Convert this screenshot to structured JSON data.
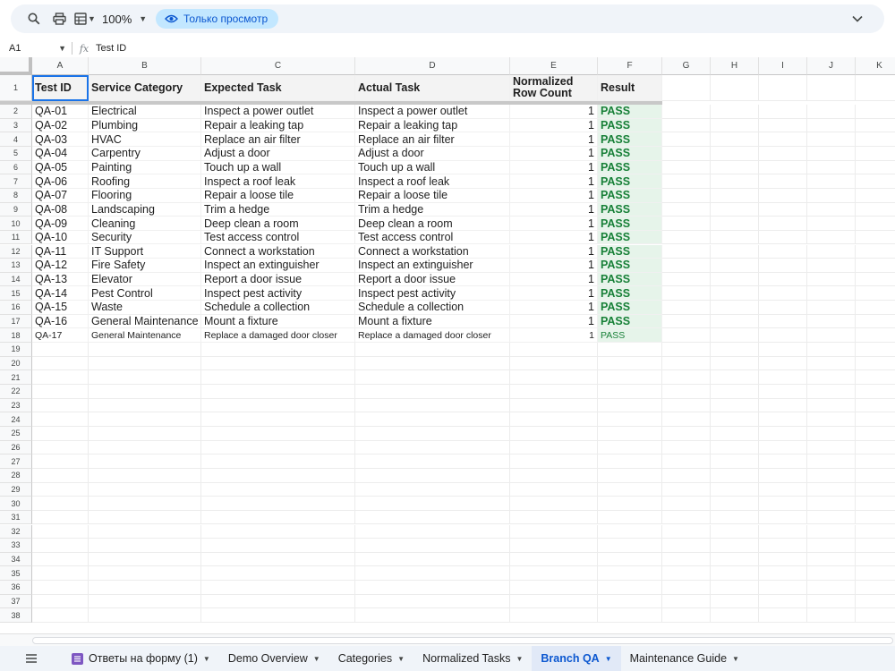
{
  "toolbar": {
    "zoom": "100%",
    "view_only_label": "Только просмотр"
  },
  "formula_bar": {
    "cell_ref": "A1",
    "fx_label": "fx",
    "value": "Test ID"
  },
  "grid": {
    "columns": [
      "A",
      "B",
      "C",
      "D",
      "E",
      "F",
      "G",
      "H",
      "I",
      "J",
      "K"
    ],
    "headers": [
      "Test ID",
      "Service Category",
      "Expected Task",
      "Actual Task",
      "Normalized Row Count",
      "Result"
    ],
    "rows": [
      [
        "QA-01",
        "Electrical",
        "Inspect a power outlet",
        "Inspect a power outlet",
        "1",
        "PASS"
      ],
      [
        "QA-02",
        "Plumbing",
        "Repair a leaking tap",
        "Repair a leaking tap",
        "1",
        "PASS"
      ],
      [
        "QA-03",
        "HVAC",
        "Replace an air filter",
        "Replace an air filter",
        "1",
        "PASS"
      ],
      [
        "QA-04",
        "Carpentry",
        "Adjust a door",
        "Adjust a door",
        "1",
        "PASS"
      ],
      [
        "QA-05",
        "Painting",
        "Touch up a wall",
        "Touch up a wall",
        "1",
        "PASS"
      ],
      [
        "QA-06",
        "Roofing",
        "Inspect a roof leak",
        "Inspect a roof leak",
        "1",
        "PASS"
      ],
      [
        "QA-07",
        "Flooring",
        "Repair a loose tile",
        "Repair a loose tile",
        "1",
        "PASS"
      ],
      [
        "QA-08",
        "Landscaping",
        "Trim a hedge",
        "Trim a hedge",
        "1",
        "PASS"
      ],
      [
        "QA-09",
        "Cleaning",
        "Deep clean a room",
        "Deep clean a room",
        "1",
        "PASS"
      ],
      [
        "QA-10",
        "Security",
        "Test access control",
        "Test access control",
        "1",
        "PASS"
      ],
      [
        "QA-11",
        "IT Support",
        "Connect a workstation",
        "Connect a workstation",
        "1",
        "PASS"
      ],
      [
        "QA-12",
        "Fire Safety",
        "Inspect an extinguisher",
        "Inspect an extinguisher",
        "1",
        "PASS"
      ],
      [
        "QA-13",
        "Elevator",
        "Report a door issue",
        "Report a door issue",
        "1",
        "PASS"
      ],
      [
        "QA-14",
        "Pest Control",
        "Inspect pest activity",
        "Inspect pest activity",
        "1",
        "PASS"
      ],
      [
        "QA-15",
        "Waste",
        "Schedule a collection",
        "Schedule a collection",
        "1",
        "PASS"
      ],
      [
        "QA-16",
        "General Maintenance",
        "Mount a fixture",
        "Mount a fixture",
        "1",
        "PASS"
      ],
      [
        "QA-17",
        "General Maintenance",
        "Replace a damaged door closer",
        "Replace a damaged door closer",
        "1",
        "PASS"
      ]
    ],
    "row_numbers": [
      "1",
      "2",
      "3",
      "4",
      "5",
      "6",
      "7",
      "8",
      "9",
      "10",
      "11",
      "12",
      "13",
      "14",
      "15",
      "16",
      "17",
      "18",
      "19",
      "20",
      "21",
      "22",
      "23",
      "24",
      "25",
      "26",
      "27",
      "28",
      "29",
      "30",
      "31",
      "32",
      "33",
      "34",
      "35",
      "36",
      "37",
      "38"
    ],
    "pass_color": "#188038",
    "pass_fill": "#e6f4ea",
    "selection_color": "#1a73e8"
  },
  "sheet_tabs": [
    {
      "label": "Ответы на форму (1)",
      "icon": "form-icon",
      "active": false
    },
    {
      "label": "Demo Overview",
      "active": false
    },
    {
      "label": "Categories",
      "active": false
    },
    {
      "label": "Normalized Tasks",
      "active": false
    },
    {
      "label": "Branch QA",
      "active": true
    },
    {
      "label": "Maintenance Guide",
      "active": false
    }
  ]
}
